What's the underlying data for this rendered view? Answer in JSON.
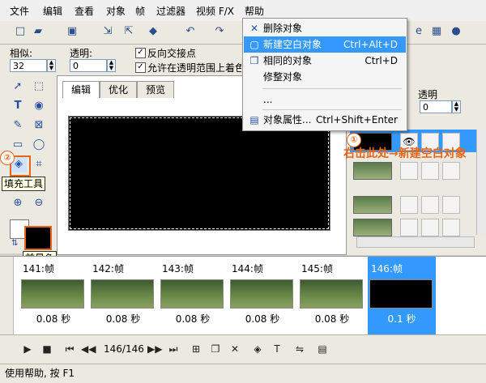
{
  "menubar": [
    "文件",
    "编辑",
    "查看",
    "对象",
    "帧",
    "过滤器",
    "视频 F/X",
    "帮助"
  ],
  "props": {
    "opacity_label": "相似:",
    "opacity_value": "32",
    "transparency_label": "透明:",
    "transparency_value": "0",
    "check1": "反向交接点",
    "check2": "允许在透明范围上着色"
  },
  "tabs": [
    "编辑",
    "优化",
    "预览"
  ],
  "context_menu": {
    "items": [
      {
        "label": "删除对象",
        "shortcut": "",
        "icon": "delete-x-icon"
      },
      {
        "label": "新建空白对象",
        "shortcut": "Ctrl+Alt+D",
        "icon": "new-object-icon"
      },
      {
        "label": "相同的对象",
        "shortcut": "Ctrl+D",
        "icon": "duplicate-icon"
      },
      {
        "label": "修整对象",
        "shortcut": "",
        "icon": ""
      },
      {
        "label": "...",
        "shortcut": "",
        "icon": ""
      },
      {
        "label": "对象属性...",
        "shortcut": "Ctrl+Shift+Enter",
        "icon": "properties-icon"
      }
    ]
  },
  "right_panel": {
    "transparency_label": "透明",
    "transparency_value": "0"
  },
  "annotations": {
    "a1_num": "①",
    "a1_text": "右击此处→新建空白对象",
    "a2_num": "②",
    "fill_tool_tip": "填充工具",
    "fg_color_tip": "前景色"
  },
  "frames": [
    {
      "label": "141:帧",
      "duration": "0.08 秒"
    },
    {
      "label": "142:帧",
      "duration": "0.08 秒"
    },
    {
      "label": "143:帧",
      "duration": "0.08 秒"
    },
    {
      "label": "144:帧",
      "duration": "0.08 秒"
    },
    {
      "label": "145:帧",
      "duration": "0.08 秒"
    },
    {
      "label": "146:帧",
      "duration": "0.1 秒"
    }
  ],
  "playback": {
    "counter": "146/146"
  },
  "status": {
    "text": "使用帮助, 按 F1"
  },
  "colors": {
    "accent": "#3399ff",
    "annotation": "#e8661a"
  }
}
